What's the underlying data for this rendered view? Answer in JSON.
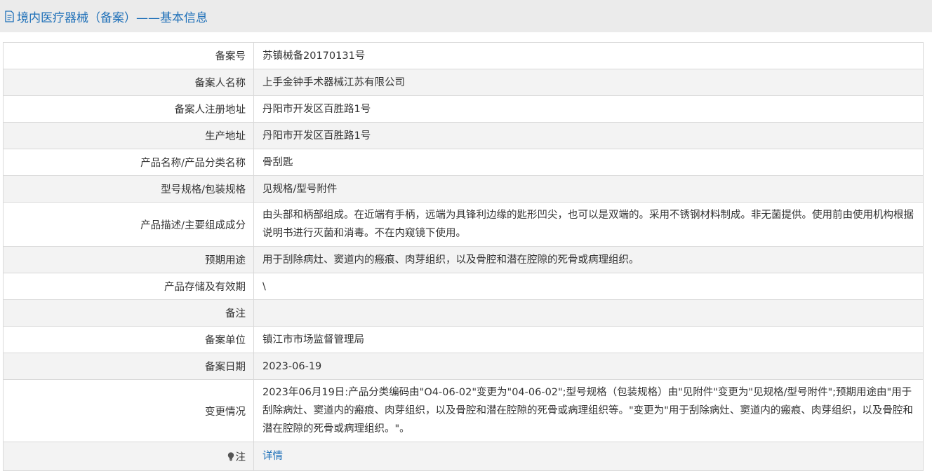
{
  "header": {
    "title": "境内医疗器械（备案）——基本信息"
  },
  "rows": [
    {
      "label": "备案号",
      "value": "苏镇械备20170131号"
    },
    {
      "label": "备案人名称",
      "value": "上手金钟手术器械江苏有限公司"
    },
    {
      "label": "备案人注册地址",
      "value": "丹阳市开发区百胜路1号"
    },
    {
      "label": "生产地址",
      "value": "丹阳市开发区百胜路1号"
    },
    {
      "label": "产品名称/产品分类名称",
      "value": "骨刮匙"
    },
    {
      "label": "型号规格/包装规格",
      "value": "见规格/型号附件"
    },
    {
      "label": "产品描述/主要组成成分",
      "value": "由头部和柄部组成。在近端有手柄，远端为具锋利边缘的匙形凹尖，也可以是双端的。采用不锈钢材料制成。非无菌提供。使用前由使用机构根据说明书进行灭菌和消毒。不在内窥镜下使用。"
    },
    {
      "label": "预期用途",
      "value": "用于刮除病灶、窦道内的瘢痕、肉芽组织，以及骨腔和潜在腔隙的死骨或病理组织。"
    },
    {
      "label": "产品存储及有效期",
      "value": "\\"
    },
    {
      "label": "备注",
      "value": ""
    },
    {
      "label": "备案单位",
      "value": "镇江市市场监督管理局"
    },
    {
      "label": "备案日期",
      "value": "2023-06-19"
    },
    {
      "label": "变更情况",
      "value": "2023年06月19日:产品分类编码由\"O4-06-02\"变更为\"04-06-02\";型号规格（包装规格）由\"见附件\"变更为\"见规格/型号附件\";预期用途由\"用于刮除病灶、窦道内的瘢痕、肉芽组织，以及骨腔和潜在腔隙的死骨或病理组织等。\"变更为\"用于刮除病灶、窦道内的瘢痕、肉芽组织，以及骨腔和潜在腔隙的死骨或病理组织。\"。"
    }
  ],
  "note_row": {
    "label": "注",
    "link_text": "详情"
  },
  "colors": {
    "title": "#1d6fb8",
    "link": "#1d6fb8",
    "alt_row": "#f3f3f3",
    "border": "#d9d9d9"
  }
}
